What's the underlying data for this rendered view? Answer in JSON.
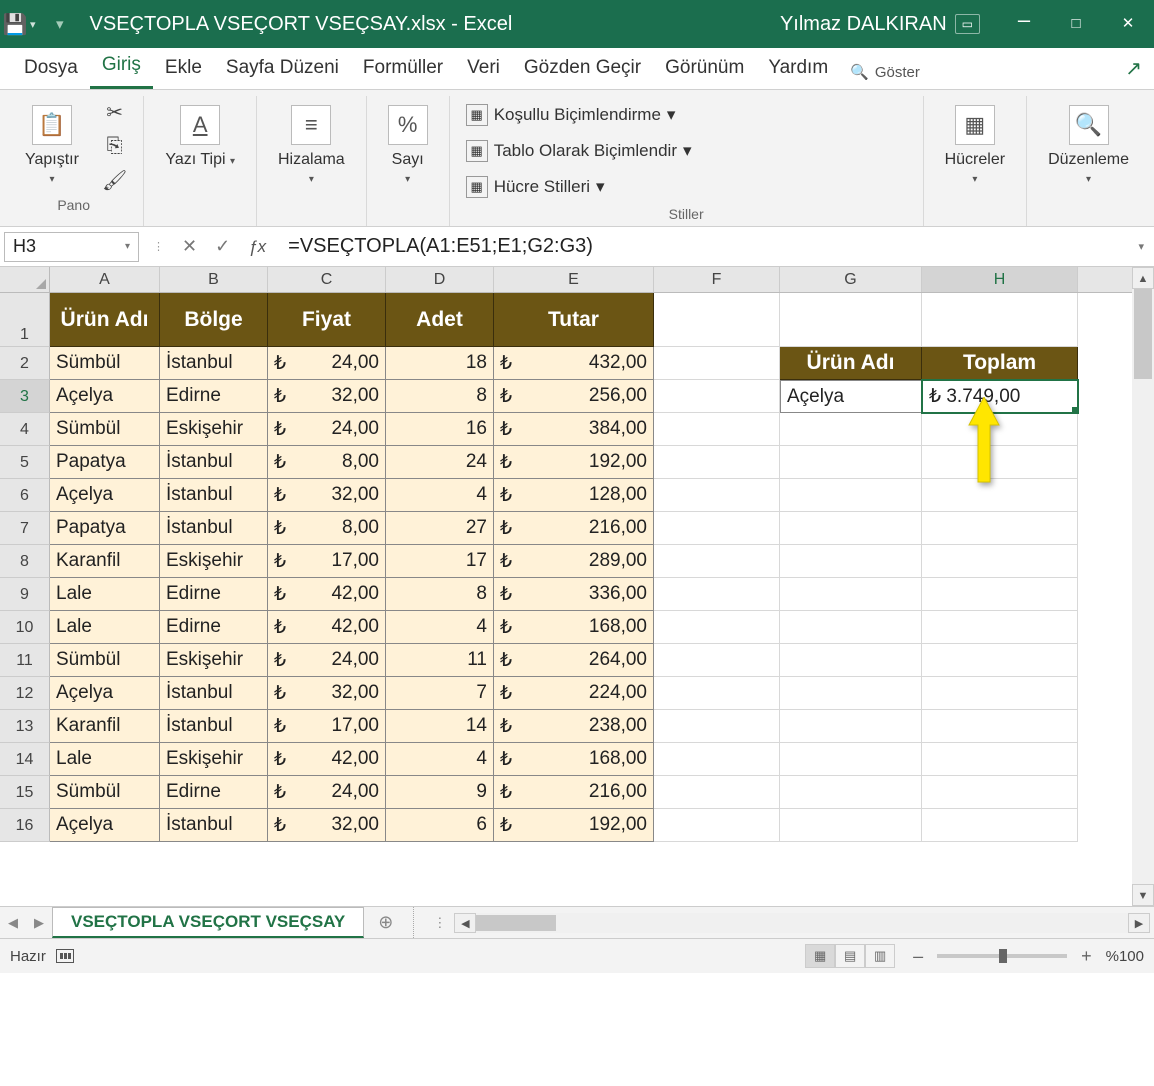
{
  "titlebar": {
    "filename": "VSEÇTOPLA VSEÇORT VSEÇSAY.xlsx  -  Excel",
    "user": "Yılmaz DALKIRAN"
  },
  "tabs": [
    "Dosya",
    "Giriş",
    "Ekle",
    "Sayfa Düzeni",
    "Formüller",
    "Veri",
    "Gözden Geçir",
    "Görünüm",
    "Yardım"
  ],
  "active_tab": "Giriş",
  "tellme": "Göster",
  "ribbon": {
    "pano": {
      "paste": "Yapıştır",
      "group": "Pano"
    },
    "font": {
      "label": "Yazı Tipi"
    },
    "align": {
      "label": "Hizalama"
    },
    "number": {
      "label": "Sayı"
    },
    "styles": {
      "cond": "Koşullu Biçimlendirme",
      "table": "Tablo Olarak Biçimlendir",
      "cell": "Hücre Stilleri",
      "group": "Stiller"
    },
    "cells": {
      "label": "Hücreler"
    },
    "editing": {
      "label": "Düzenleme"
    }
  },
  "namebox": "H3",
  "formula": "=VSEÇTOPLA(A1:E51;E1;G2:G3)",
  "columns": [
    "A",
    "B",
    "C",
    "D",
    "E",
    "F",
    "G",
    "H"
  ],
  "header_row": [
    "Ürün Adı",
    "Bölge",
    "Fiyat",
    "Adet",
    "Tutar"
  ],
  "criteria": {
    "g2": "Ürün Adı",
    "h2": "Toplam",
    "g3": "Açelya",
    "h3": "₺  3.749,00"
  },
  "data_rows": [
    {
      "r": 2,
      "a": "Sümbül",
      "b": "İstanbul",
      "c": "24,00",
      "d": "18",
      "e": "432,00"
    },
    {
      "r": 3,
      "a": "Açelya",
      "b": "Edirne",
      "c": "32,00",
      "d": "8",
      "e": "256,00"
    },
    {
      "r": 4,
      "a": "Sümbül",
      "b": "Eskişehir",
      "c": "24,00",
      "d": "16",
      "e": "384,00"
    },
    {
      "r": 5,
      "a": "Papatya",
      "b": "İstanbul",
      "c": "8,00",
      "d": "24",
      "e": "192,00"
    },
    {
      "r": 6,
      "a": "Açelya",
      "b": "İstanbul",
      "c": "32,00",
      "d": "4",
      "e": "128,00"
    },
    {
      "r": 7,
      "a": "Papatya",
      "b": "İstanbul",
      "c": "8,00",
      "d": "27",
      "e": "216,00"
    },
    {
      "r": 8,
      "a": "Karanfil",
      "b": "Eskişehir",
      "c": "17,00",
      "d": "17",
      "e": "289,00"
    },
    {
      "r": 9,
      "a": "Lale",
      "b": "Edirne",
      "c": "42,00",
      "d": "8",
      "e": "336,00"
    },
    {
      "r": 10,
      "a": "Lale",
      "b": "Edirne",
      "c": "42,00",
      "d": "4",
      "e": "168,00"
    },
    {
      "r": 11,
      "a": "Sümbül",
      "b": "Eskişehir",
      "c": "24,00",
      "d": "11",
      "e": "264,00"
    },
    {
      "r": 12,
      "a": "Açelya",
      "b": "İstanbul",
      "c": "32,00",
      "d": "7",
      "e": "224,00"
    },
    {
      "r": 13,
      "a": "Karanfil",
      "b": "İstanbul",
      "c": "17,00",
      "d": "14",
      "e": "238,00"
    },
    {
      "r": 14,
      "a": "Lale",
      "b": "Eskişehir",
      "c": "42,00",
      "d": "4",
      "e": "168,00"
    },
    {
      "r": 15,
      "a": "Sümbül",
      "b": "Edirne",
      "c": "24,00",
      "d": "9",
      "e": "216,00"
    },
    {
      "r": 16,
      "a": "Açelya",
      "b": "İstanbul",
      "c": "32,00",
      "d": "6",
      "e": "192,00"
    }
  ],
  "sheet_tab": "VSEÇTOPLA VSEÇORT VSEÇSAY",
  "status": {
    "ready": "Hazır",
    "zoom": "%100"
  },
  "currency": "₺"
}
